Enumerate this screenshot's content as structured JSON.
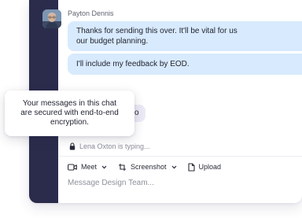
{
  "conversation": {
    "sender_name": "Payton Dennis",
    "messages": [
      {
        "text_line1": "Thanks for sending this over. It'll be vital for us",
        "text_line2": "our budget planning."
      },
      {
        "text": "I'll include my feedback by EOD."
      }
    ],
    "partial_message_tail": "o",
    "typing_indicator": "Lena Oxton is typing..."
  },
  "encryption_tooltip": {
    "line1": "Your messages in this chat",
    "line2": "are secured with end-to-end",
    "line3": "encryption."
  },
  "toolbar": {
    "meet_label": "Meet",
    "screenshot_label": "Screenshot",
    "upload_label": "Upload"
  },
  "composer": {
    "placeholder": "Message Design Team..."
  },
  "colors": {
    "sidebar": "#2b2c4c",
    "outgoing_bubble": "#d8eafd",
    "incoming_bubble": "#eceaf6"
  },
  "icons": [
    "lock-icon",
    "video-icon",
    "screenshot-icon",
    "file-icon",
    "chevron-down-icon"
  ]
}
